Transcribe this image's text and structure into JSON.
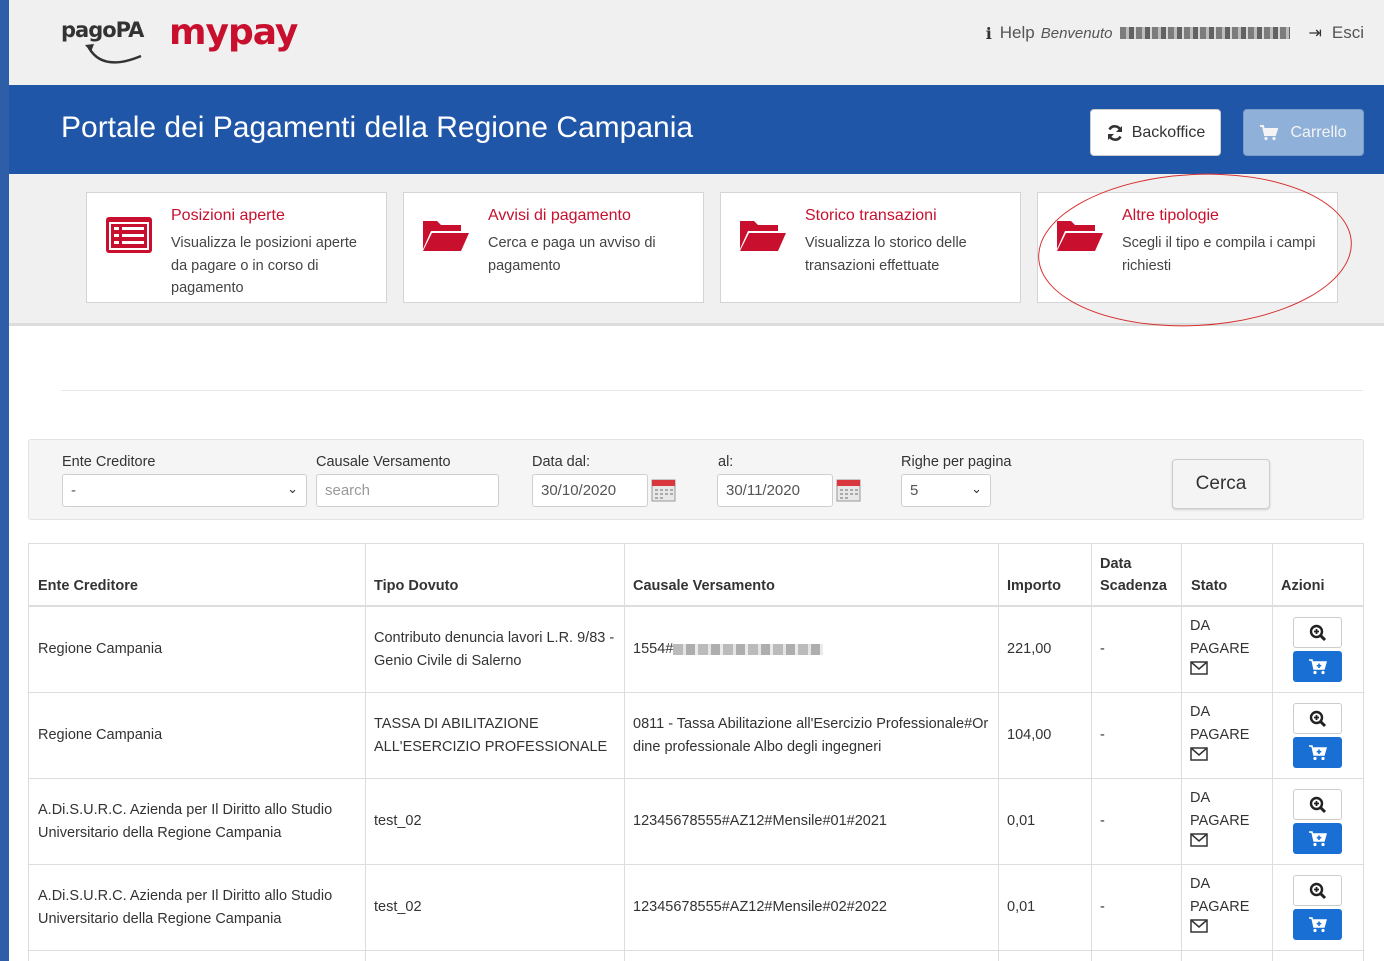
{
  "header": {
    "logo_pagopa": "pagoPA",
    "logo_mypay": "mypay",
    "help_label": "Help",
    "welcome_label": "Benvenuto",
    "exit_label": "Esci"
  },
  "banner": {
    "title": "Portale dei Pagamenti della Regione Campania",
    "backoffice_label": "Backoffice",
    "carrello_label": "Carrello"
  },
  "tiles": [
    {
      "title": "Posizioni aperte",
      "desc": "Visualizza le posizioni aperte da pagare o in corso di pagamento",
      "icon": "list-icon"
    },
    {
      "title": "Avvisi di pagamento",
      "desc": "Cerca e paga un avviso di pagamento",
      "icon": "folder-open-icon"
    },
    {
      "title": "Storico transazioni",
      "desc": "Visualizza lo storico delle transazioni effettuate",
      "icon": "folder-open-icon"
    },
    {
      "title": "Altre tipologie",
      "desc": "Scegli il tipo e compila i campi richiesti",
      "icon": "folder-open-icon"
    }
  ],
  "filter": {
    "ente_label": "Ente Creditore",
    "ente_value": "-",
    "causale_label": "Causale Versamento",
    "causale_placeholder": "search",
    "dal_label": "Data dal:",
    "dal_value": "30/10/2020",
    "al_label": "al:",
    "al_value": "30/11/2020",
    "righe_label": "Righe per pagina",
    "righe_value": "5",
    "cerca_label": "Cerca"
  },
  "table": {
    "headers": {
      "ente": "Ente Creditore",
      "tipo": "Tipo Dovuto",
      "causale": "Causale Versamento",
      "importo": "Importo",
      "scadenza": "Data Scadenza",
      "stato": "Stato",
      "azioni": "Azioni"
    },
    "rows": [
      {
        "ente": "Regione Campania",
        "tipo": "Contributo denuncia lavori L.R. 9/83 - Genio Civile di Salerno",
        "causale": "1554#",
        "importo": "221,00",
        "scadenza": "-",
        "stato": "DA PAGARE"
      },
      {
        "ente": "Regione Campania",
        "tipo": "TASSA DI ABILITAZIONE ALL'ESERCIZIO PROFESSIONALE",
        "causale": "0811 - Tassa Abilitazione all'Esercizio Professionale#Ordine professionale Albo degli ingegneri",
        "importo": "104,00",
        "scadenza": "-",
        "stato": "DA PAGARE"
      },
      {
        "ente": "A.Di.S.U.R.C. Azienda per Il Diritto allo Studio Universitario della Regione Campania",
        "tipo": "test_02",
        "causale": "12345678555#AZ12#Mensile#01#2021",
        "importo": "0,01",
        "scadenza": "-",
        "stato": "DA PAGARE"
      },
      {
        "ente": "A.Di.S.U.R.C. Azienda per Il Diritto allo Studio Universitario della Regione Campania",
        "tipo": "test_02",
        "causale": "12345678555#AZ12#Mensile#02#2022",
        "importo": "0,01",
        "scadenza": "-",
        "stato": "DA PAGARE"
      }
    ]
  },
  "colors": {
    "brand_blue": "#1f56a8",
    "accent_red": "#c8102e",
    "cart_blue": "#1a6fd4"
  }
}
